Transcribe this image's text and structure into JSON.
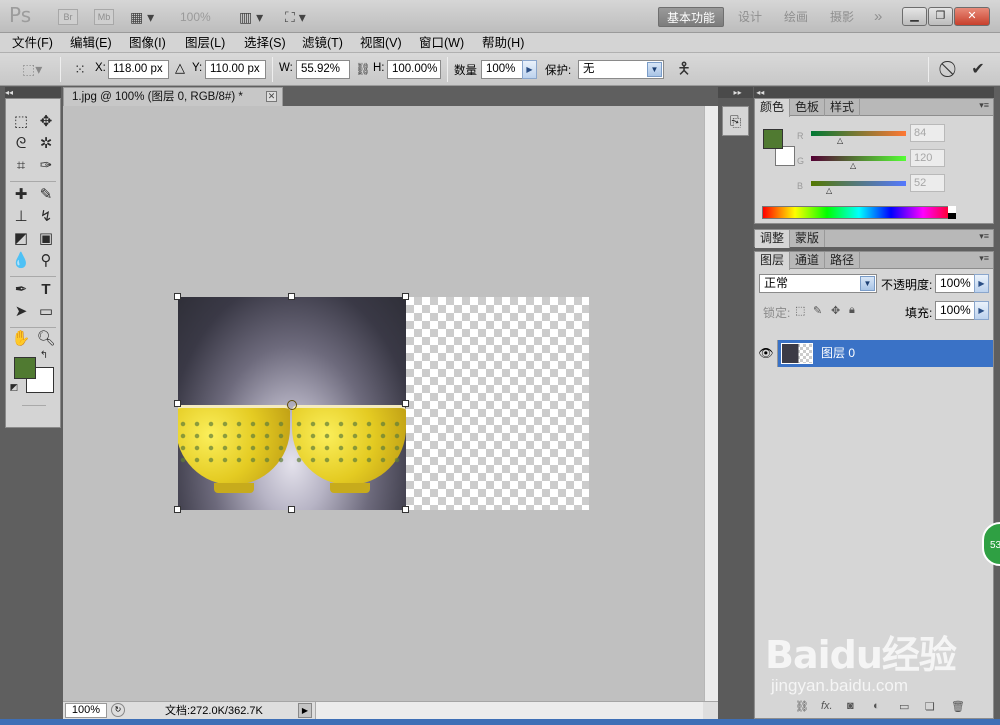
{
  "app": {
    "logo": "Ps",
    "mini_bridge_label": "Br",
    "mini_mb_label": "Mb",
    "zoom_level": "100%"
  },
  "workspaces": [
    "基本功能",
    "设计",
    "绘画",
    "摄影"
  ],
  "workspace_more": "»",
  "menu": [
    "文件(F)",
    "编辑(E)",
    "图像(I)",
    "图层(L)",
    "选择(S)",
    "滤镜(T)",
    "视图(V)",
    "窗口(W)",
    "帮助(H)"
  ],
  "options": {
    "x_label": "X:",
    "x_value": "118.00 px",
    "delta": "△",
    "y_label": "Y:",
    "y_value": "110.00 px",
    "w_label": "W:",
    "w_value": "55.92%",
    "h_label": "H:",
    "h_value": "100.00%",
    "amount_label": "数量",
    "amount_value": "100%",
    "protect_label": "保护:",
    "protect_value": "无"
  },
  "document": {
    "tab_title": "1.jpg @ 100% (图层 0, RGB/8#) *",
    "status_zoom": "100%",
    "status_doc": "文档:272.0K/362.7K"
  },
  "color_panel": {
    "tabs": [
      "颜色",
      "色板",
      "样式"
    ],
    "fg_color": "#507a31",
    "r_label": "R",
    "r_value": "84",
    "g_label": "G",
    "g_value": "120",
    "b_label": "B",
    "b_value": "52"
  },
  "adjust_panel": {
    "tabs": [
      "调整",
      "蒙版"
    ]
  },
  "layers_panel": {
    "tabs": [
      "图层",
      "通道",
      "路径"
    ],
    "blend_mode": "正常",
    "opacity_label": "不透明度:",
    "opacity_value": "100%",
    "lock_label": "锁定:",
    "fill_label": "填充:",
    "fill_value": "100%",
    "layers": [
      {
        "name": "图层 0",
        "selected": true,
        "visible": true
      }
    ]
  },
  "watermark": {
    "text": "Baidu经验",
    "url": "jingyan.baidu.com"
  },
  "badge": "53"
}
